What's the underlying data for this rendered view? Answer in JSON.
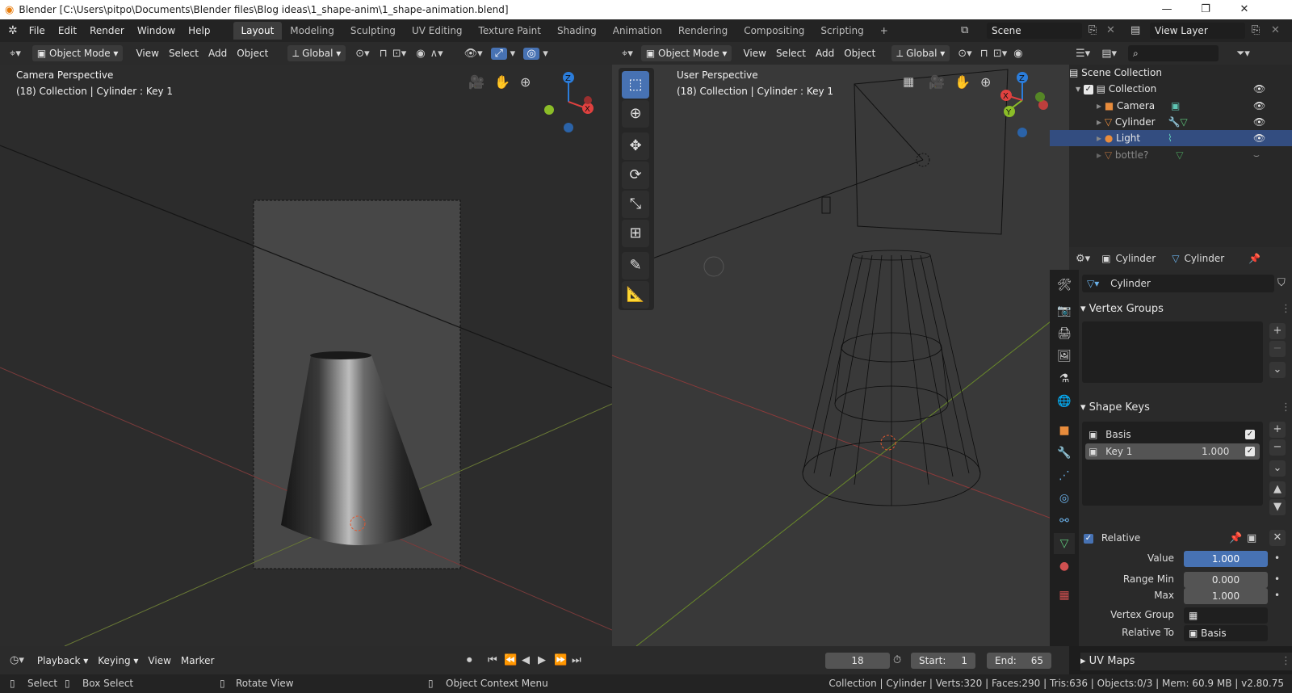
{
  "window": {
    "title": "Blender [C:\\Users\\pitpo\\Documents\\Blender files\\Blog ideas\\1_shape-anim\\1_shape-animation.blend]",
    "minimize": "—",
    "maximize": "❐",
    "close": "✕"
  },
  "menus": [
    "File",
    "Edit",
    "Render",
    "Window",
    "Help"
  ],
  "workspaces": [
    "Layout",
    "Modeling",
    "Sculpting",
    "UV Editing",
    "Texture Paint",
    "Shading",
    "Animation",
    "Rendering",
    "Compositing",
    "Scripting"
  ],
  "workspace_add": "+",
  "scene": {
    "label": "Scene"
  },
  "view_layer": {
    "label": "View Layer"
  },
  "left_header": {
    "mode": "Object Mode",
    "view": "View",
    "select": "Select",
    "add": "Add",
    "object": "Object",
    "transform": "Global"
  },
  "right_header": {
    "mode": "Object Mode",
    "view": "View",
    "select": "Select",
    "add": "Add",
    "object": "Object",
    "transform": "Global"
  },
  "left_viewport": {
    "title": "Camera Perspective",
    "subtitle": "(18) Collection | Cylinder : Key 1"
  },
  "right_viewport": {
    "title": "User Perspective",
    "subtitle": "(18) Collection | Cylinder : Key 1"
  },
  "gizmo": {
    "z": "Z",
    "x": "X",
    "y": "Y"
  },
  "outliner": {
    "search_placeholder": "",
    "rows": [
      {
        "label": "Scene Collection"
      },
      {
        "label": "Collection"
      },
      {
        "label": "Camera"
      },
      {
        "label": "Cylinder"
      },
      {
        "label": "Light"
      },
      {
        "label": "bottle?"
      }
    ]
  },
  "properties": {
    "object_name": "Cylinder",
    "data_name": "Cylinder",
    "mesh_field": "Cylinder",
    "vertex_groups": "Vertex Groups",
    "shape_keys": "Shape Keys",
    "keys": [
      {
        "name": "Basis",
        "value": ""
      },
      {
        "name": "Key 1",
        "value": "1.000"
      }
    ],
    "relative": "Relative",
    "value_label": "Value",
    "value": "1.000",
    "range_min_label": "Range Min",
    "range_min": "0.000",
    "max_label": "Max",
    "max": "1.000",
    "vertex_group_label": "Vertex Group",
    "relative_to_label": "Relative To",
    "relative_to": "Basis",
    "uv_maps": "UV Maps"
  },
  "timeline": {
    "playback": "Playback",
    "keying": "Keying",
    "view": "View",
    "marker": "Marker",
    "frame": "18",
    "start_label": "Start:",
    "start": "1",
    "end_label": "End:",
    "end": "65"
  },
  "status": {
    "select": "Select",
    "box_select": "Box Select",
    "rotate": "Rotate View",
    "context": "Object Context Menu",
    "info": "Collection | Cylinder | Verts:320 | Faces:290 | Tris:636 | Objects:0/3 | Mem: 60.9 MB | v2.80.75"
  },
  "colors": {
    "accent": "#4772b3",
    "axis_x": "#e0413f",
    "axis_y": "#8bbd28",
    "axis_z": "#2b7ddb"
  }
}
